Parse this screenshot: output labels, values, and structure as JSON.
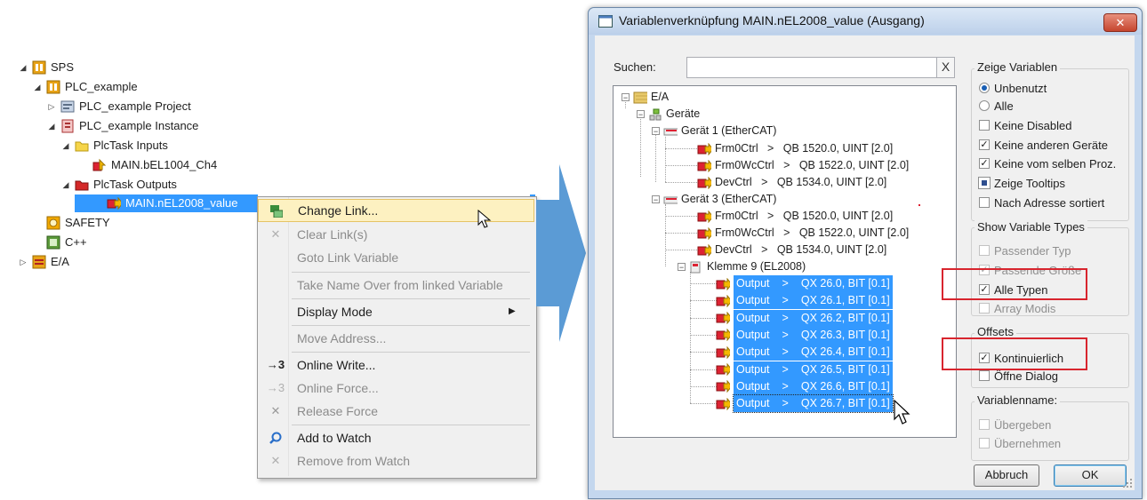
{
  "tree": {
    "items": [
      {
        "label": "SPS",
        "arrow": "◢",
        "icon": "plc-project-icon"
      },
      {
        "label": "PLC_example",
        "arrow": "◢",
        "icon": "plc-icon"
      },
      {
        "label": "PLC_example Project",
        "arrow": "▷",
        "icon": "project-file-icon"
      },
      {
        "label": "PLC_example Instance",
        "arrow": "◢",
        "icon": "instance-icon"
      },
      {
        "label": "PlcTask Inputs",
        "arrow": "◢",
        "icon": "yellow-folder-icon"
      },
      {
        "label": "MAIN.bEL1004_Ch4",
        "arrow": "",
        "icon": "input-variable-icon"
      },
      {
        "label": "PlcTask Outputs",
        "arrow": "◢",
        "icon": "red-folder-icon"
      },
      {
        "label": "MAIN.nEL2008_value",
        "arrow": "",
        "icon": "output-variable-icon"
      },
      {
        "label": "SAFETY",
        "arrow": "",
        "icon": "safety-icon"
      },
      {
        "label": "C++",
        "arrow": "",
        "icon": "cpp-icon"
      },
      {
        "label": "E/A",
        "arrow": "▷",
        "icon": "io-icon"
      }
    ]
  },
  "context_menu": {
    "items": [
      {
        "label": "Change Link...",
        "icon": "change-link-icon",
        "glyph": "",
        "enabled": true
      },
      {
        "label": "Clear Link(s)",
        "icon": "clear-link-icon",
        "glyph": "✕",
        "enabled": false
      },
      {
        "label": "Goto Link Variable",
        "icon": "",
        "glyph": "",
        "enabled": false
      },
      {
        "label": "Take Name Over from linked Variable",
        "icon": "",
        "glyph": "",
        "enabled": false
      },
      {
        "label": "Display Mode",
        "icon": "",
        "glyph": "",
        "enabled": true
      },
      {
        "label": "Move Address...",
        "icon": "",
        "glyph": "",
        "enabled": false
      },
      {
        "label": "Online Write...",
        "icon": "online-write-icon",
        "glyph": "→3",
        "enabled": true
      },
      {
        "label": "Online Force...",
        "icon": "online-force-icon",
        "glyph": "→3",
        "enabled": false
      },
      {
        "label": "Release Force",
        "icon": "release-force-icon",
        "glyph": "✕",
        "enabled": false
      },
      {
        "label": "Add to Watch",
        "icon": "add-to-watch-icon",
        "glyph": "",
        "enabled": true
      },
      {
        "label": "Remove from Watch",
        "icon": "remove-from-watch-icon",
        "glyph": "✕",
        "enabled": false
      }
    ]
  },
  "dialog": {
    "title": "Variablenverknüpfung MAIN.nEL2008_value (Ausgang)",
    "close_glyph": "✕",
    "search_label": "Suchen:",
    "search_value": "",
    "clear_glyph": "X",
    "tree": {
      "root": "E/A",
      "devices": "Geräte",
      "device1": "Gerät 1 (EtherCAT)",
      "device1_vars": [
        {
          "name": "Frm0Ctrl",
          "addr": "QB 1520.0, UINT [2.0]"
        },
        {
          "name": "Frm0WcCtrl",
          "addr": "QB 1522.0, UINT [2.0]"
        },
        {
          "name": "DevCtrl",
          "addr": "QB 1534.0, UINT [2.0]"
        }
      ],
      "device3": "Gerät 3 (EtherCAT)",
      "device3_vars": [
        {
          "name": "Frm0Ctrl",
          "addr": "QB 1520.0, UINT [2.0]"
        },
        {
          "name": "Frm0WcCtrl",
          "addr": "QB 1522.0, UINT [2.0]"
        },
        {
          "name": "DevCtrl",
          "addr": "QB 1534.0, UINT [2.0]"
        }
      ],
      "terminal": "Klemme 9 (EL2008)",
      "outputs": [
        {
          "name": "Output",
          "addr": "QX 26.0, BIT [0.1]"
        },
        {
          "name": "Output",
          "addr": "QX 26.1, BIT [0.1]"
        },
        {
          "name": "Output",
          "addr": "QX 26.2, BIT [0.1]"
        },
        {
          "name": "Output",
          "addr": "QX 26.3, BIT [0.1]"
        },
        {
          "name": "Output",
          "addr": "QX 26.4, BIT [0.1]"
        },
        {
          "name": "Output",
          "addr": "QX 26.5, BIT [0.1]"
        },
        {
          "name": "Output",
          "addr": "QX 26.6, BIT [0.1]"
        },
        {
          "name": "Output",
          "addr": "QX 26.7, BIT [0.1]"
        }
      ],
      "sep": ">"
    },
    "show_vars": {
      "title": "Zeige Variablen",
      "unbenutzt": "Unbenutzt",
      "alle": "Alle",
      "keine_disabled": "Keine Disabled",
      "keine_anderen": "Keine anderen Geräte",
      "keine_selben": "Keine vom selben Proz.",
      "zeige_tooltips": "Zeige Tooltips",
      "nach_adresse": "Nach Adresse sortiert"
    },
    "show_types": {
      "title": "Show Variable Types",
      "passender_typ": "Passender Typ",
      "passende_groesse": "Passende Größe",
      "alle_typen": "Alle Typen",
      "array_modis": "Array Modis"
    },
    "offsets": {
      "title": "Offsets",
      "kontinuierlich": "Kontinuierlich",
      "oeffne_dialog": "Öffne Dialog"
    },
    "varname": {
      "title": "Variablenname:",
      "uebergeben": "Übergeben",
      "uebernehmen": "Übernehmen"
    },
    "cancel_label": "Abbruch",
    "ok_label": "OK"
  },
  "check": "✓",
  "colors": {
    "selection": "#3399ff",
    "highlight_box": "#d8252e",
    "arrow": "#5b9bd5"
  }
}
